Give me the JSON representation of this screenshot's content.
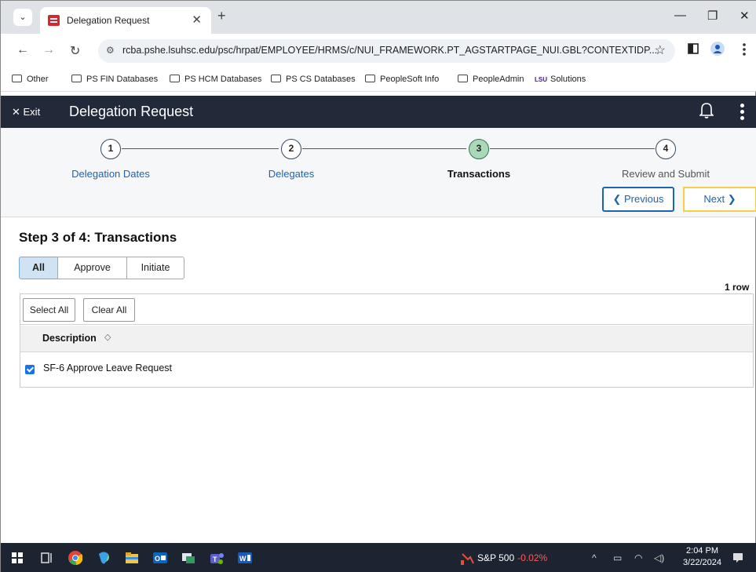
{
  "browser": {
    "tab_title": "Delegation Request",
    "new_tab": "+",
    "url": "rcba.pshe.lsuhsc.edu/psc/hrpat/EMPLOYEE/HRMS/c/NUI_FRAMEWORK.PT_AGSTARTPAGE_NUI.GBL?CONTEXTIDP...",
    "bookmarks": [
      "Other",
      "PS FIN Databases",
      "PS HCM Databases",
      "PS CS Databases",
      "PeopleSoft Info",
      "PeopleAdmin",
      "Solutions"
    ]
  },
  "header": {
    "exit_label": "Exit",
    "title": "Delegation Request"
  },
  "steps": [
    {
      "number": "1",
      "label": "Delegation Dates",
      "state": "completed"
    },
    {
      "number": "2",
      "label": "Delegates",
      "state": "completed"
    },
    {
      "number": "3",
      "label": "Transactions",
      "state": "current"
    },
    {
      "number": "4",
      "label": "Review and Submit",
      "state": "future"
    }
  ],
  "nav_buttons": {
    "previous": "Previous",
    "next": "Next"
  },
  "page": {
    "heading": "Step 3 of 4: Transactions",
    "filters": [
      "All",
      "Approve",
      "Initiate"
    ],
    "selected_filter": "All",
    "row_count": "1 row",
    "select_all": "Select All",
    "clear_all": "Clear All",
    "column_header": "Description",
    "rows": [
      {
        "label": "SF-6 Approve Leave Request",
        "checked": true
      }
    ]
  },
  "taskbar": {
    "stock_name": "S&P 500",
    "stock_change": "-0.02%",
    "time": "2:04 PM",
    "date": "3/22/2024"
  },
  "colors": {
    "header_bg": "#222a3a",
    "link_blue": "#1e63b0",
    "active_step": "#a9d9b7",
    "next_border": "#f5cf47"
  }
}
